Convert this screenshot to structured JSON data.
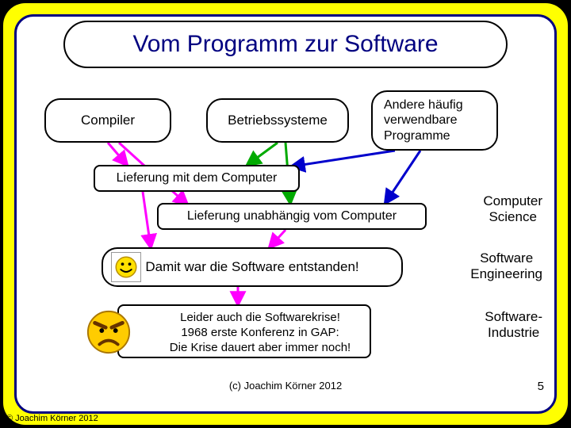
{
  "title": "Vom Programm zur Software",
  "boxes": {
    "compiler": "Compiler",
    "os": "Betriebssysteme",
    "other": "Andere häufig verwendbare Programme",
    "deliv1": "Lieferung mit dem Computer",
    "deliv2": "Lieferung unabhängig vom Computer",
    "born": "Damit war die Software entstanden!",
    "crisis": "Leider auch die Softwarekrise!\n1968 erste Konferenz in GAP:\nDie Krise dauert aber immer noch!"
  },
  "side": {
    "cs": "Computer\nScience",
    "se": "Software\nEngineering",
    "si": "Software-\nIndustrie"
  },
  "meta": {
    "copyright": "(c) Joachim Körner 2012",
    "footer": "© Joachim Körner 2012",
    "page": "5"
  }
}
